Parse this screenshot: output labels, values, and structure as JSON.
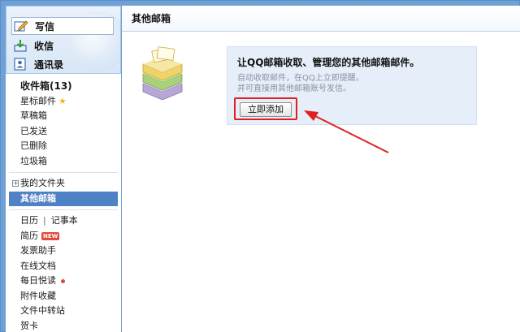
{
  "sidebar": {
    "quick": [
      {
        "label": "写信",
        "icon": "compose-icon"
      },
      {
        "label": "收信",
        "icon": "inbox-download-icon"
      },
      {
        "label": "通讯录",
        "icon": "contacts-icon"
      }
    ],
    "inbox": "收件箱(13)",
    "items": [
      {
        "label": "星标邮件"
      },
      {
        "label": "草稿箱"
      },
      {
        "label": "已发送"
      },
      {
        "label": "已删除"
      },
      {
        "label": "垃圾箱"
      }
    ],
    "folders": "我的文件夹",
    "other_mailboxes": "其他邮箱",
    "apps": {
      "calendar": "日历",
      "separator": "|",
      "notes": "记事本",
      "resume": "简历",
      "resume_badge": "NEW",
      "invoice": "发票助手",
      "docs": "在线文档",
      "daily_reading": "每日悦读",
      "attachments": "附件收藏",
      "file_transfer": "文件中转站",
      "cards": "贺卡"
    }
  },
  "main": {
    "title": "其他邮箱",
    "card": {
      "title": "让QQ邮箱收取、管理您的其他邮箱邮件。",
      "desc1": "自动收取邮件，在QQ上立即提醒。",
      "desc2": "并可直接用其他邮箱账号发信。",
      "button": "立即添加"
    }
  },
  "colors": {
    "frame": "#6fa1d6",
    "active_nav": "#4f81c5",
    "card_bg": "#e5eef9",
    "highlight": "#e02020"
  }
}
